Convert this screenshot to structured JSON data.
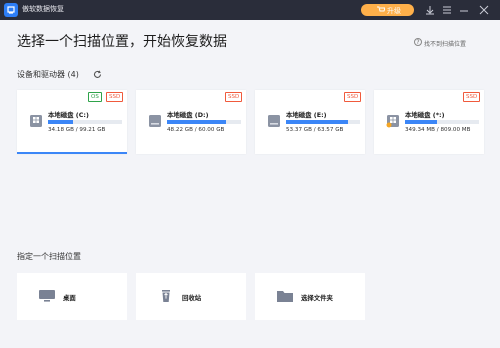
{
  "app": {
    "title": "傲软数据恢复",
    "upgrade_label": "升级"
  },
  "header": {
    "title": "选择一个扫描位置，开始恢复数据",
    "help_text": "找不到扫描位置"
  },
  "devices": {
    "section_title": "设备和驱动器 (4)",
    "drives": [
      {
        "name": "本地磁盘 (C:)",
        "size": "34.18 GB / 99.21 GB",
        "usage": 0.34,
        "badges": [
          "OS",
          "SSD"
        ],
        "icon": "windows-drive-icon"
      },
      {
        "name": "本地磁盘 (D:)",
        "size": "48.22 GB / 60.00 GB",
        "usage": 0.8,
        "badges": [
          "SSD"
        ],
        "icon": "hard-drive-icon"
      },
      {
        "name": "本地磁盘 (E:)",
        "size": "53.37 GB / 63.57 GB",
        "usage": 0.84,
        "badges": [
          "SSD"
        ],
        "icon": "hard-drive-icon"
      },
      {
        "name": "本地磁盘 (*:)",
        "size": "349.34 MB / 809.00 MB",
        "usage": 0.43,
        "badges": [
          "SSD"
        ],
        "icon": "windows-drive-warning-icon"
      }
    ]
  },
  "locations": {
    "section_title": "指定一个扫描位置",
    "items": [
      {
        "label": "桌面",
        "icon": "desktop-icon"
      },
      {
        "label": "回收站",
        "icon": "recycle-bin-icon"
      },
      {
        "label": "选择文件夹",
        "icon": "folder-icon"
      }
    ]
  },
  "colors": {
    "titlebar": "#2a2d3a",
    "accent": "#3b86f7",
    "upgrade": "#ffb04a",
    "ssd_badge": "#f05a3c",
    "os_badge": "#2fa34a"
  }
}
